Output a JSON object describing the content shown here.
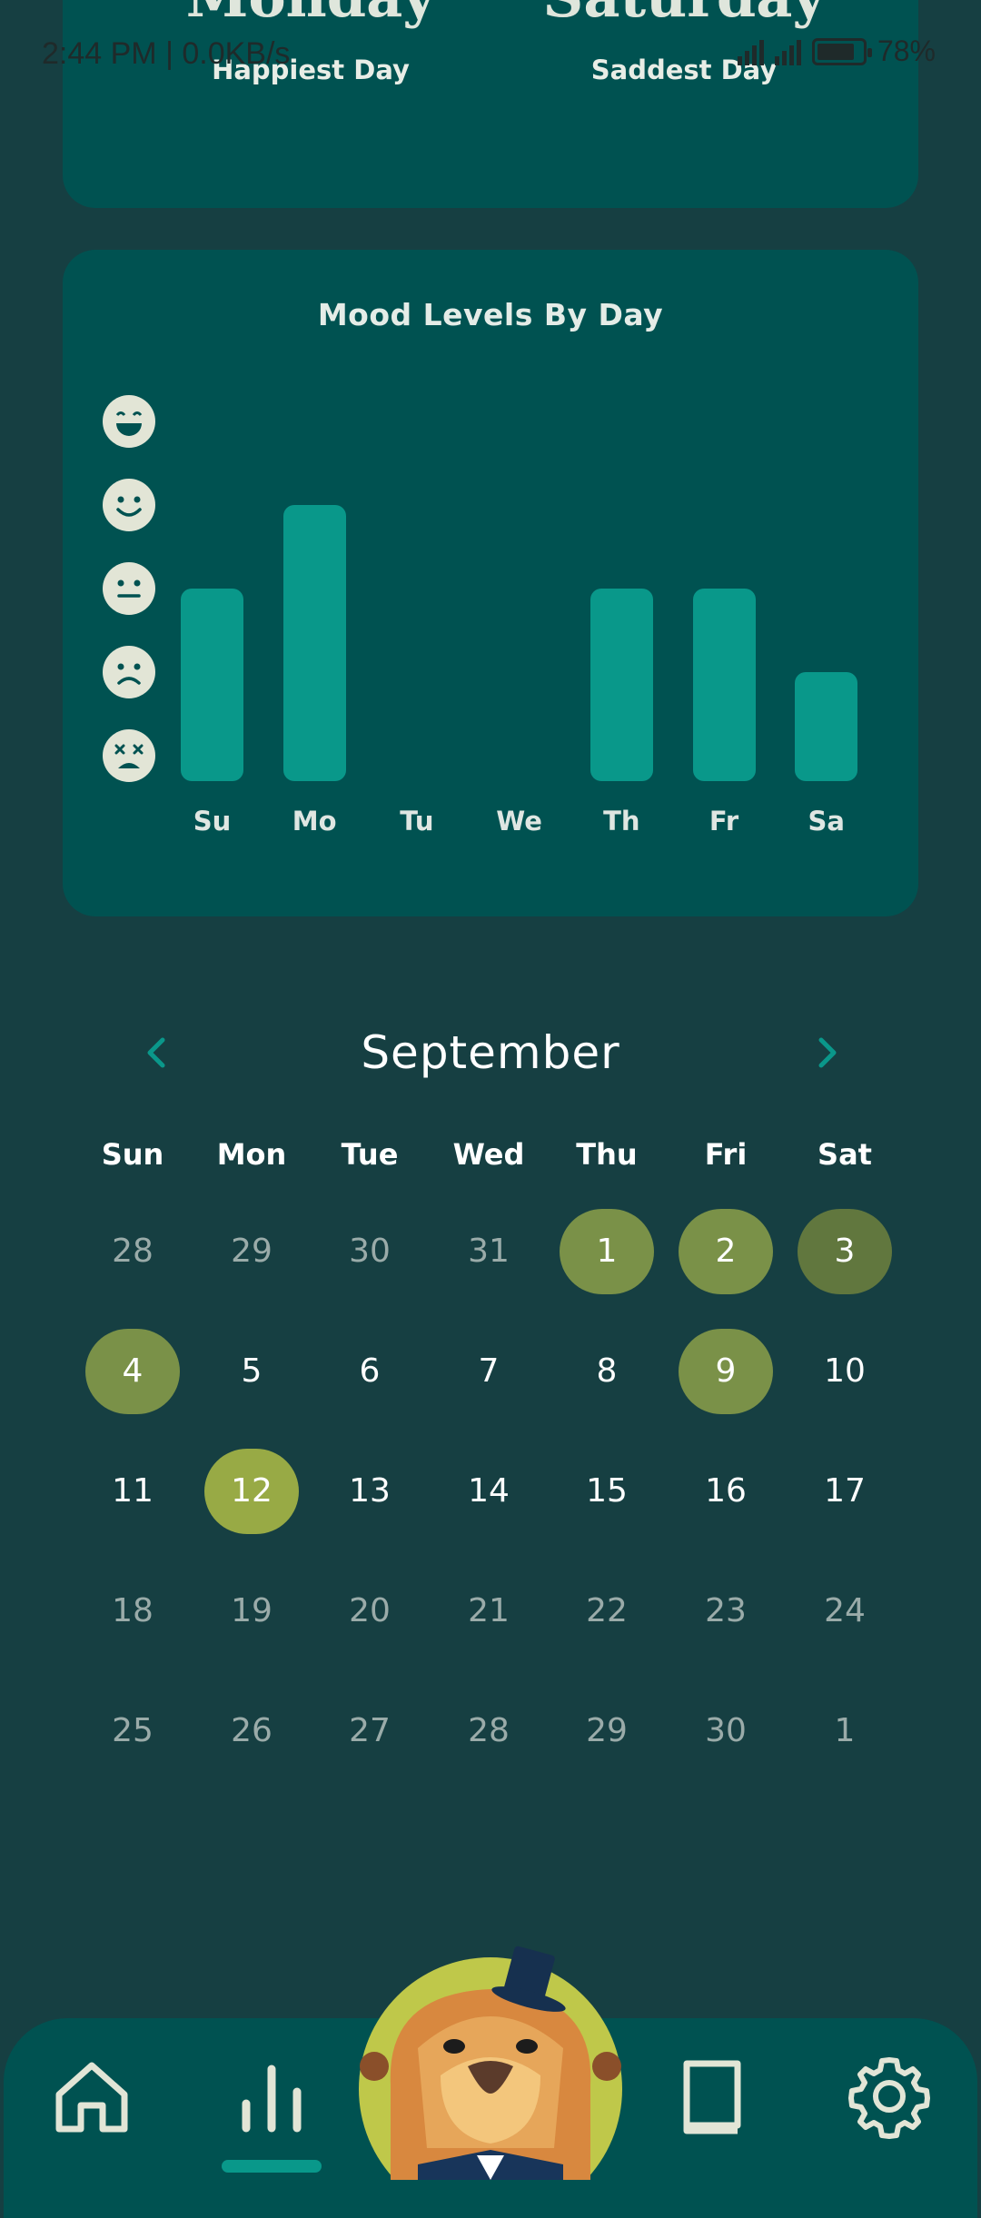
{
  "status_bar": {
    "time": "2:44 PM | 0.0KB/s",
    "battery": "78%"
  },
  "summary": {
    "happiest_day": "Monday",
    "happiest_label": "Happiest Day",
    "saddest_day": "Saturday",
    "saddest_label": "Saddest Day"
  },
  "mood_chart": {
    "title": "Mood Levels By Day",
    "icons": [
      "very-happy-icon",
      "happy-icon",
      "neutral-face-icon",
      "sad-face-icon",
      "very-sad-face-icon"
    ]
  },
  "chart_data": {
    "type": "bar",
    "title": "Mood Levels By Day",
    "categories": [
      "Su",
      "Mo",
      "Tu",
      "We",
      "Th",
      "Fr",
      "Sa"
    ],
    "values": [
      3,
      4,
      null,
      null,
      3,
      3,
      2
    ],
    "ylim": [
      1,
      5
    ],
    "ylabel": "",
    "xlabel": "",
    "grid": false,
    "colors": {
      "bar": "#09988a"
    }
  },
  "calendar": {
    "month": "September",
    "prev_icon": "chevron-left-icon",
    "next_icon": "chevron-right-icon",
    "weekdays": [
      "Sun",
      "Mon",
      "Tue",
      "Wed",
      "Thu",
      "Fri",
      "Sat"
    ],
    "weeks": [
      [
        {
          "d": "28",
          "muted": true
        },
        {
          "d": "29",
          "muted": true
        },
        {
          "d": "30",
          "muted": true
        },
        {
          "d": "31",
          "muted": true
        },
        {
          "d": "1",
          "mark": 1
        },
        {
          "d": "2",
          "mark": 1
        },
        {
          "d": "3",
          "mark": 2
        }
      ],
      [
        {
          "d": "4",
          "mark": 1
        },
        {
          "d": "5"
        },
        {
          "d": "6"
        },
        {
          "d": "7"
        },
        {
          "d": "8"
        },
        {
          "d": "9",
          "mark": 1
        },
        {
          "d": "10"
        }
      ],
      [
        {
          "d": "11"
        },
        {
          "d": "12",
          "mark": 3
        },
        {
          "d": "13"
        },
        {
          "d": "14"
        },
        {
          "d": "15"
        },
        {
          "d": "16"
        },
        {
          "d": "17"
        }
      ],
      [
        {
          "d": "18",
          "muted": true
        },
        {
          "d": "19",
          "muted": true
        },
        {
          "d": "20",
          "muted": true
        },
        {
          "d": "21",
          "muted": true
        },
        {
          "d": "22",
          "muted": true
        },
        {
          "d": "23",
          "muted": true
        },
        {
          "d": "24",
          "muted": true
        }
      ],
      [
        {
          "d": "25",
          "muted": true
        },
        {
          "d": "26",
          "muted": true
        },
        {
          "d": "27",
          "muted": true
        },
        {
          "d": "28",
          "muted": true
        },
        {
          "d": "29",
          "muted": true
        },
        {
          "d": "30",
          "muted": true
        },
        {
          "d": "1",
          "muted": true
        }
      ]
    ],
    "mark_colors": {
      "1": "#7a9148",
      "2": "#61773e",
      "3": "#98aa45"
    }
  },
  "nav": {
    "items": [
      "home-icon",
      "stats-icon",
      "mascot-button",
      "journal-icon",
      "settings-icon"
    ],
    "active": "stats-icon"
  }
}
